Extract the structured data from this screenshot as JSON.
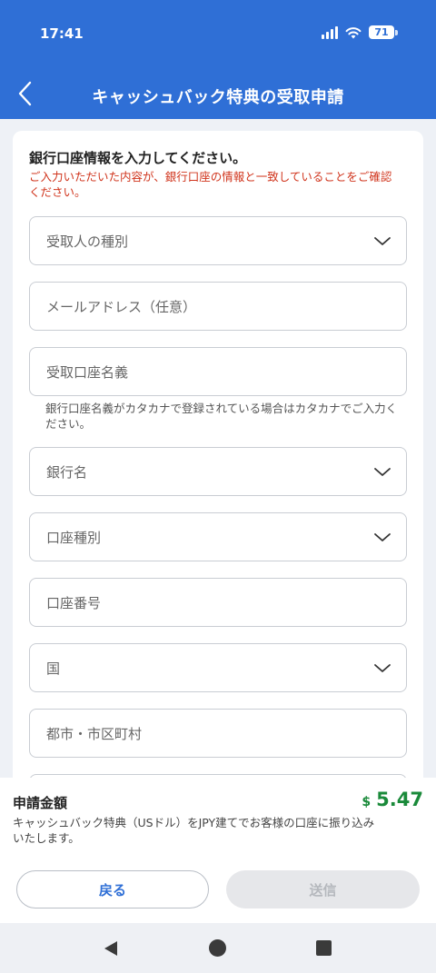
{
  "status": {
    "time": "17:41",
    "battery": "71"
  },
  "header": {
    "title": "キャッシュバック特典の受取申請"
  },
  "intro": {
    "heading": "銀行口座情報を入力してください。",
    "warning": "ご入力いただいた内容が、銀行口座の情報と一致していることをご確認ください。"
  },
  "fields": {
    "recipient_type": "受取人の種別",
    "email": "メールアドレス（任意）",
    "account_name": "受取口座名義",
    "account_name_hint": "銀行口座名義がカタカナで登録されている場合はカタカナでご入力ください。",
    "bank_name": "銀行名",
    "account_type": "口座種別",
    "account_number": "口座番号",
    "country": "国",
    "city": "都市・市区町村"
  },
  "summary": {
    "label": "申請金額",
    "currency": "$",
    "amount": "5.47",
    "description": "キャッシュバック特典（USドル）をJPY建てでお客様の口座に振り込みいたします。"
  },
  "buttons": {
    "back": "戻る",
    "send": "送信"
  },
  "colors": {
    "primary": "#2f6fd6",
    "warning": "#d0341c",
    "amount": "#1a8a3a"
  }
}
